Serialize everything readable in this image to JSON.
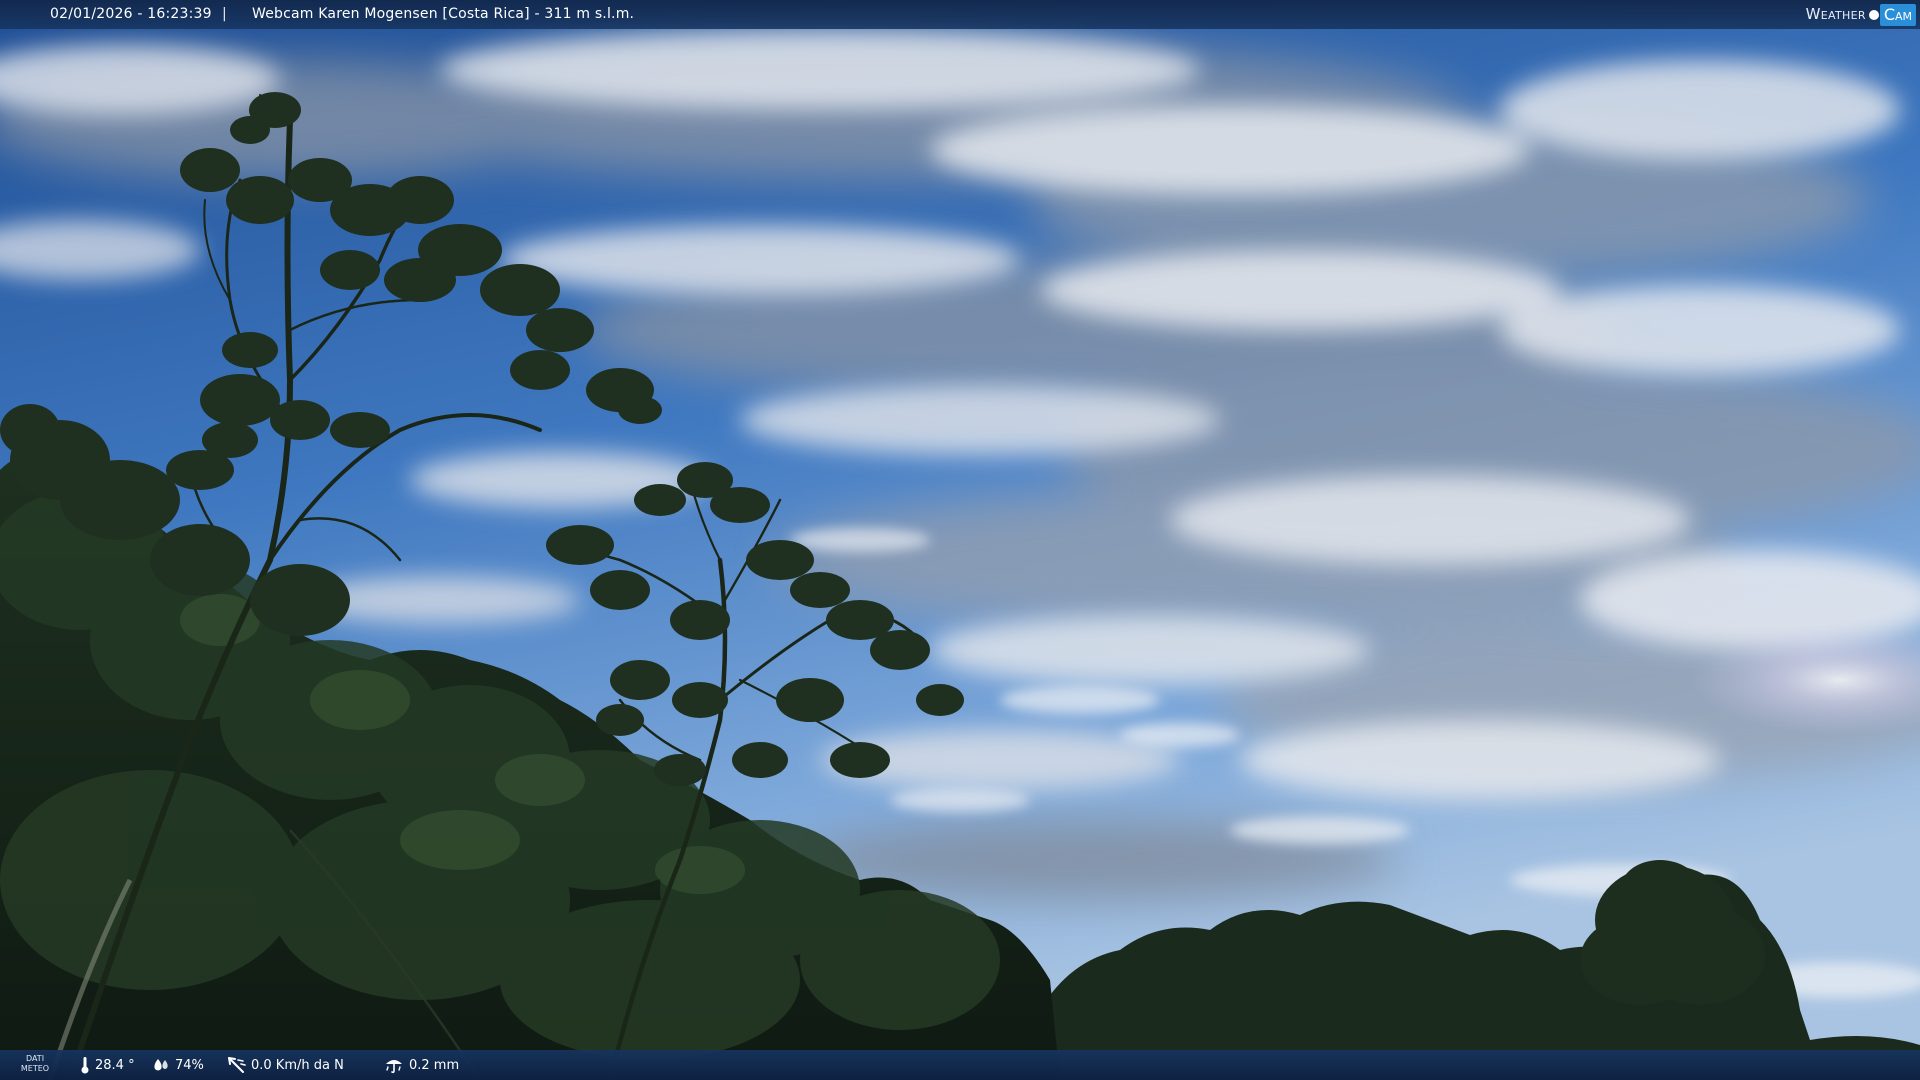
{
  "header": {
    "timestamp": "02/01/2026 - 16:23:39",
    "separator": "|",
    "title": "Webcam Karen Mogensen [Costa Rica]  - 311 m s.l.m."
  },
  "logo": {
    "weather_text": "Weather",
    "cam_text": "Cam",
    "accent_color": "#2a8fd8"
  },
  "footer": {
    "dati_label": "DATI",
    "meteo_label": "METEO",
    "temperature": "28.4 °",
    "humidity": "74%",
    "wind": "0.0 Km/h da N",
    "rain": "0.2 mm",
    "icons": {
      "temperature": "thermometer-icon",
      "humidity": "drops-icon",
      "wind": "wind-icon",
      "rain": "rain-gauge-icon"
    }
  },
  "colors": {
    "sky_top": "#2a5fa8",
    "sky_bottom": "#7aa8d8",
    "bar": "#16345f",
    "foliage": "#1a2a1a"
  }
}
